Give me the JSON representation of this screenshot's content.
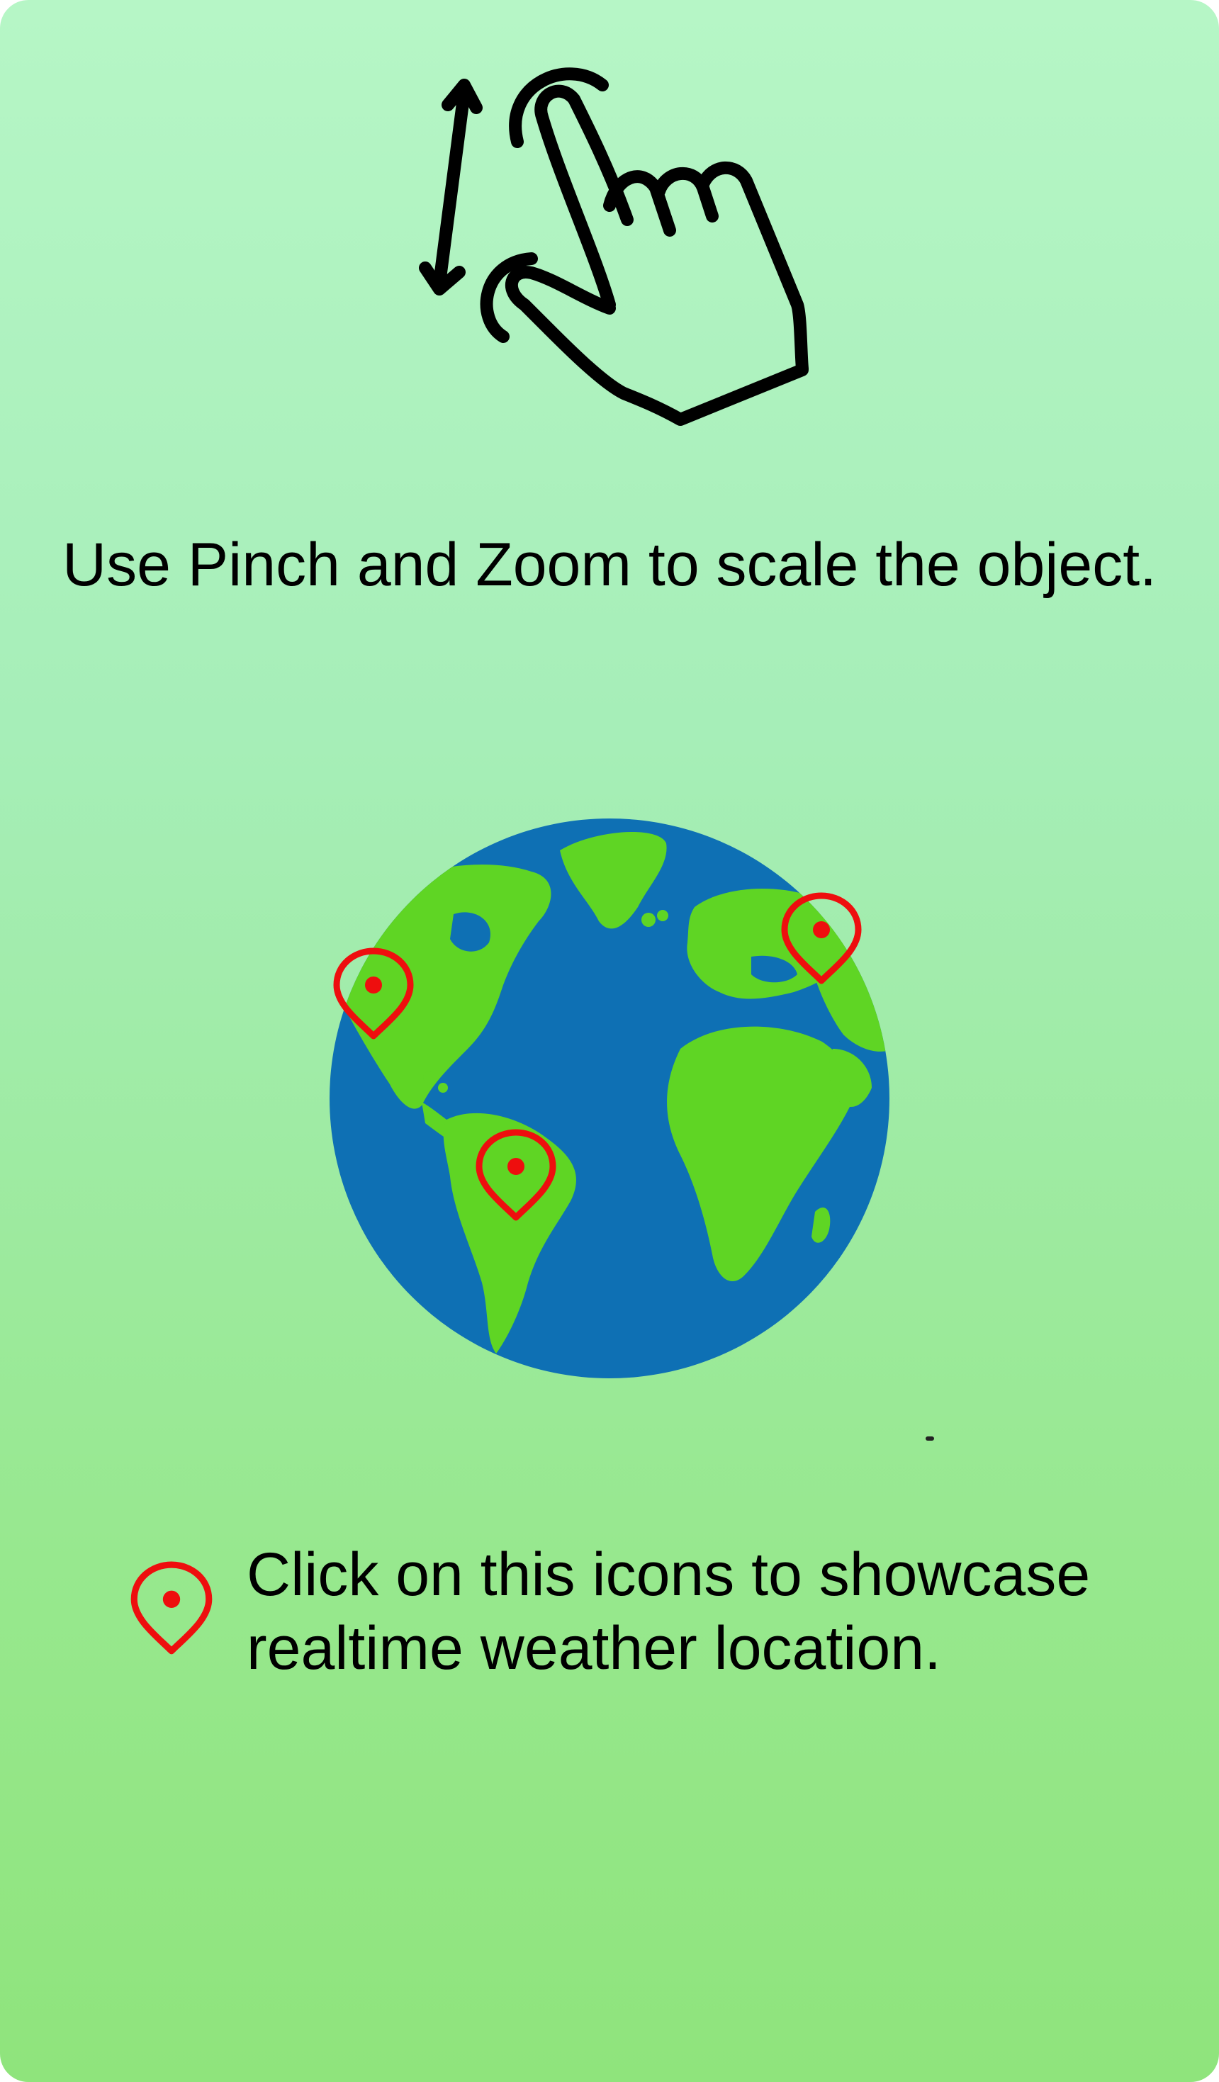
{
  "pinch": {
    "icon": "pinch-zoom-icon",
    "caption": "Use Pinch and Zoom to scale the object."
  },
  "globe": {
    "icon": "globe-icon",
    "ocean_color": "#0e70b4",
    "land_color": "#5fd524",
    "markers": [
      {
        "icon": "location-pin-icon",
        "region": "north-america"
      },
      {
        "icon": "location-pin-icon",
        "region": "europe"
      },
      {
        "icon": "location-pin-icon",
        "region": "south-america"
      }
    ]
  },
  "info": {
    "icon": "location-pin-icon",
    "text_line1": "Click on this icons to showcase",
    "text_line2": "realtime weather location."
  },
  "colors": {
    "marker": "#ee0e0e",
    "background_top": "#b6f6c6",
    "background_bottom": "#8fe47c"
  }
}
